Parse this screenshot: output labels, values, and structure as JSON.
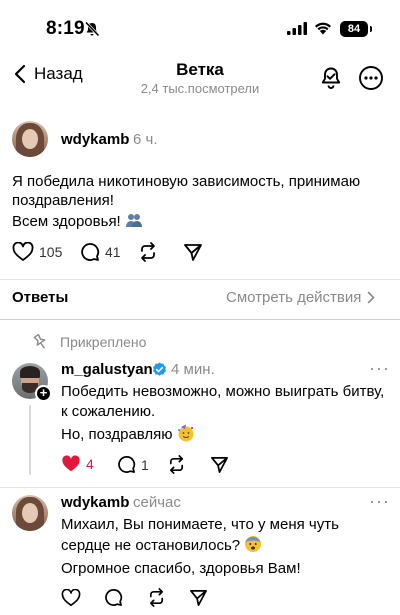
{
  "status_bar": {
    "time": "8:19",
    "battery": "84"
  },
  "nav": {
    "back_label": "Назад",
    "title": "Ветка",
    "subtitle": "2,4 тыс.посмотрели"
  },
  "main_post": {
    "username": "wdykamb",
    "time": "6 ч.",
    "text_line1": "Я победила никотиновую зависимость, принимаю",
    "text_line2": "поздравления!",
    "text_line3": "Всем здоровья!",
    "likes": "105",
    "comments": "41"
  },
  "replies_header": {
    "label": "Ответы",
    "actions_link": "Смотреть действия"
  },
  "pinned_label": "Прикреплено",
  "reply1": {
    "username": "m_galustyan",
    "time": "4 мин.",
    "text_line1": "Победить невозможно, можно выиграть битву,",
    "text_line2": "к сожалению.",
    "text_line3": "Но, поздравляю",
    "likes": "4",
    "comments": "1"
  },
  "reply2": {
    "username": "wdykamb",
    "time": "сейчас",
    "text_line1": "Михаил, Вы понимаете, что у меня чуть",
    "text_line2": "сердце не остановилось?",
    "text_line3": "Огромное спасибо, здоровья Вам!"
  },
  "colors": {
    "like_red": "#e0183c",
    "verified_blue": "#1d9bf0",
    "muted": "#8a8a8a"
  },
  "icons": [
    "muted-bell-icon",
    "signal-icon",
    "wifi-icon",
    "battery-icon",
    "chevron-left-icon",
    "notification-bell-icon",
    "more-icon",
    "heart-icon",
    "comment-icon",
    "repost-icon",
    "share-icon",
    "pin-icon",
    "verified-icon",
    "chevron-right-icon"
  ]
}
